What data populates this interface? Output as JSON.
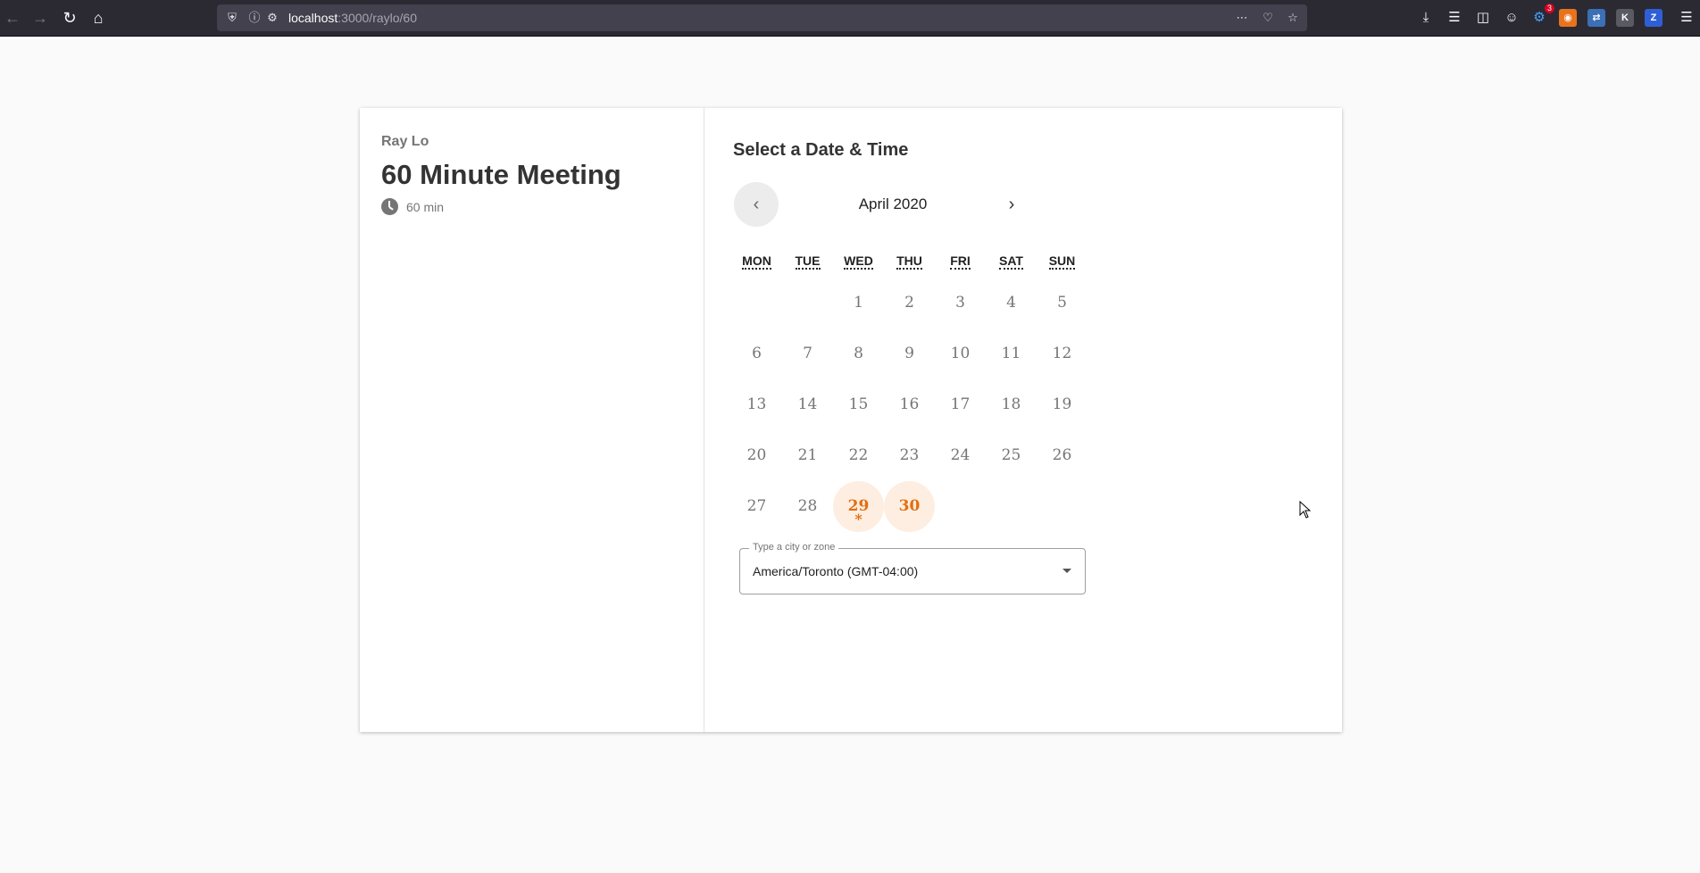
{
  "browser": {
    "url_host": "localhost",
    "url_path": ":3000/raylo/60",
    "notification_count": "3",
    "ext_k": "K",
    "ext_z": "Z"
  },
  "profile": {
    "host_name": "Ray Lo",
    "event_title": "60 Minute Meeting",
    "duration": "60 min"
  },
  "scheduler": {
    "section_title": "Select a Date & Time",
    "month_label": "April 2020",
    "prev_label": "‹",
    "next_label": "›",
    "weekdays": [
      "MON",
      "TUE",
      "WED",
      "THU",
      "FRI",
      "SAT",
      "SUN"
    ],
    "days": [
      "1",
      "2",
      "3",
      "4",
      "5",
      "6",
      "7",
      "8",
      "9",
      "10",
      "11",
      "12",
      "13",
      "14",
      "15",
      "16",
      "17",
      "18",
      "19",
      "20",
      "21",
      "22",
      "23",
      "24",
      "25",
      "26",
      "27",
      "28",
      "29",
      "30"
    ],
    "available_days": [
      "29",
      "30"
    ],
    "today_marker": "*",
    "accent_color": "#e46e10"
  },
  "timezone": {
    "label": "Type a city or zone",
    "value": "America/Toronto (GMT-04:00)"
  }
}
